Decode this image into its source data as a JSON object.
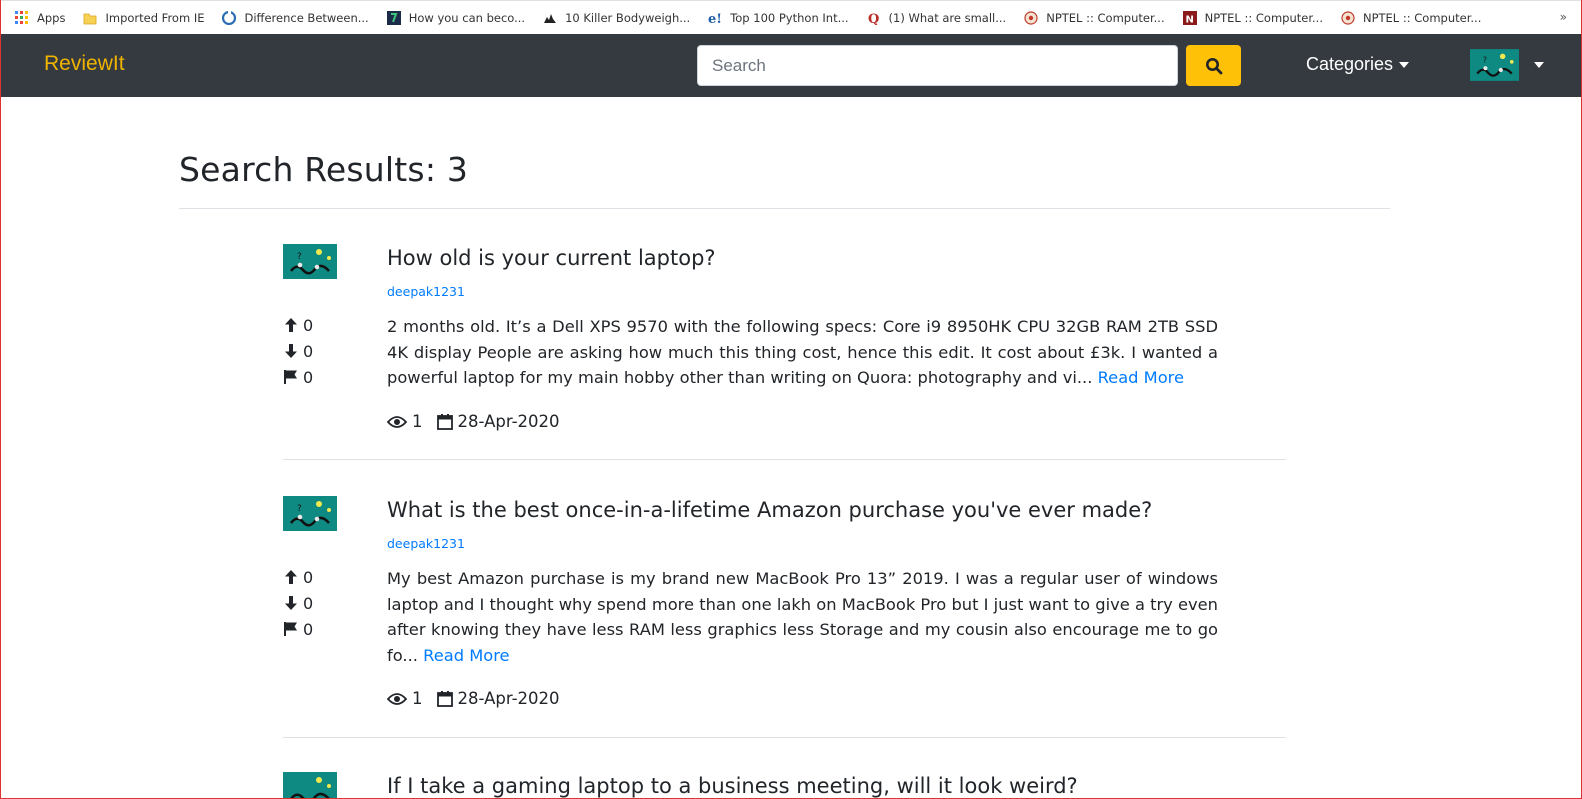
{
  "bookmarks": [
    {
      "label": "Apps",
      "icon": "apps-grid-icon"
    },
    {
      "label": "Imported From IE",
      "icon": "folder-icon"
    },
    {
      "label": "Difference Between...",
      "icon": "site-icon"
    },
    {
      "label": "How you can beco...",
      "icon": "site-icon"
    },
    {
      "label": "10 Killer Bodyweigh...",
      "icon": "site-icon"
    },
    {
      "label": "Top 100 Python Int...",
      "icon": "site-icon"
    },
    {
      "label": "(1) What are small...",
      "icon": "quora-icon"
    },
    {
      "label": "NPTEL :: Computer...",
      "icon": "nptel-icon"
    },
    {
      "label": "NPTEL :: Computer...",
      "icon": "nptel-icon"
    },
    {
      "label": "NPTEL :: Computer...",
      "icon": "nptel-icon"
    }
  ],
  "bookmarks_more": "»",
  "navbar": {
    "brand": "ReviewIt",
    "search_placeholder": "Search",
    "categories_label": "Categories"
  },
  "colors": {
    "brand": "#f0b400",
    "navbar_bg": "#343a40",
    "search_button": "#ffc107",
    "link": "#007bff"
  },
  "results": {
    "title": "Search Results: 3",
    "posts": [
      {
        "title": "How old is your current laptop?",
        "author": "deepak1231",
        "upvotes": "0",
        "downvotes": "0",
        "flags": "0",
        "excerpt": "2 months old. It’s a Dell XPS 9570 with the following specs: Core i9 8950HK CPU 32GB RAM 2TB SSD 4K display People are asking how much this thing cost, hence this edit. It cost about £3k. I wanted a powerful laptop for my main hobby other than writing on Quora: photography and vi...",
        "read_more": "Read More",
        "views": "1",
        "date": "28-Apr-2020"
      },
      {
        "title": "What is the best once-in-a-lifetime Amazon purchase you've ever made?",
        "author": "deepak1231",
        "upvotes": "0",
        "downvotes": "0",
        "flags": "0",
        "excerpt": "My best Amazon purchase is my brand new MacBook Pro 13” 2019. I was a regular user of windows laptop and I thought why spend more than one lakh on MacBook Pro but I just want to give a try even after knowing they have less RAM less graphics less Storage and my cousin also encourage me to go fo...",
        "read_more": "Read More",
        "views": "1",
        "date": "28-Apr-2020"
      },
      {
        "title": "If I take a gaming laptop to a business meeting, will it look weird?"
      }
    ]
  }
}
